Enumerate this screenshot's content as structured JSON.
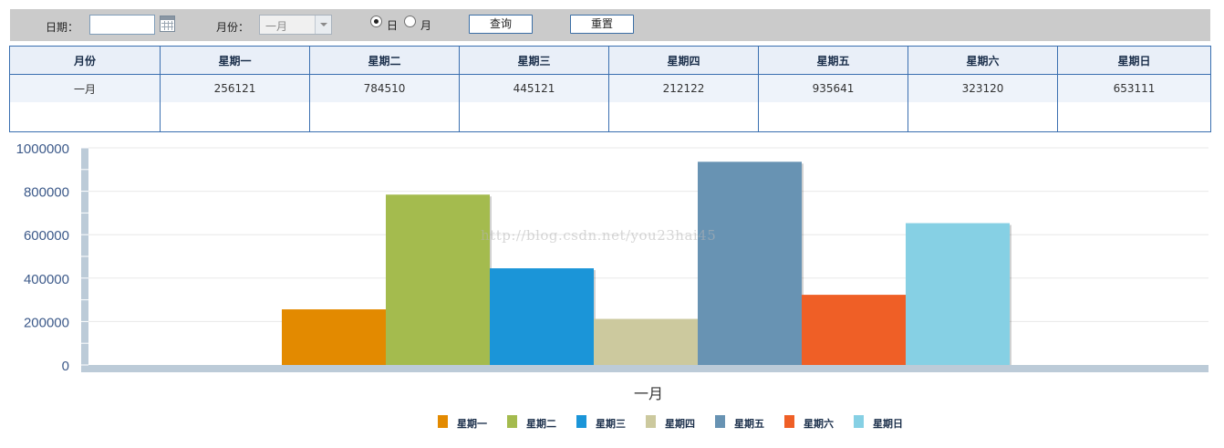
{
  "toolbar": {
    "date_label": "日期：",
    "date_value": "",
    "month_label": "月份：",
    "month_selected": "一月",
    "radio_day": "日",
    "radio_month": "月",
    "radio_selected": "day",
    "query_label": "查询",
    "reset_label": "重置"
  },
  "table": {
    "headers": [
      "月份",
      "星期一",
      "星期二",
      "星期三",
      "星期四",
      "星期五",
      "星期六",
      "星期日"
    ],
    "row1": [
      "一月",
      "256121",
      "784510",
      "445121",
      "212122",
      "935641",
      "323120",
      "653111"
    ]
  },
  "watermark": "http://blog.csdn.net/you23hai45",
  "chart_data": {
    "type": "bar",
    "categories": [
      "一月"
    ],
    "xlabel": "",
    "ylabel": "",
    "ylim": [
      0,
      1000000
    ],
    "yticks": [
      "0",
      "200000",
      "400000",
      "600000",
      "800000",
      "1000000"
    ],
    "grid": true,
    "legend_position": "bottom",
    "series": [
      {
        "name": "星期一",
        "values": [
          256121
        ],
        "color": "#e38a00"
      },
      {
        "name": "星期二",
        "values": [
          784510
        ],
        "color": "#a4bb4e"
      },
      {
        "name": "星期三",
        "values": [
          445121
        ],
        "color": "#1b95d8"
      },
      {
        "name": "星期四",
        "values": [
          212122
        ],
        "color": "#ccc99e"
      },
      {
        "name": "星期五",
        "values": [
          935641
        ],
        "color": "#6893b3"
      },
      {
        "name": "星期六",
        "values": [
          323120
        ],
        "color": "#ef5f26"
      },
      {
        "name": "星期日",
        "values": [
          653111
        ],
        "color": "#86d0e4"
      }
    ]
  }
}
